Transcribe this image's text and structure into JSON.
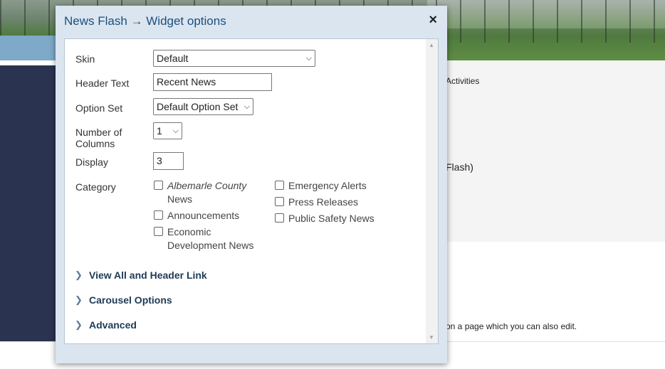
{
  "background": {
    "text1": "Activities",
    "text2": "Flash)",
    "text3": "on a page which you can also edit."
  },
  "dialog": {
    "title": "News Flash → Widget options",
    "close_icon": "×",
    "fields": {
      "skin": {
        "label": "Skin",
        "value": "Default"
      },
      "header_text": {
        "label": "Header Text",
        "value": "Recent News"
      },
      "option_set": {
        "label": "Option Set",
        "value": "Default Option Set"
      },
      "columns": {
        "label": "Number of Columns",
        "value": "1"
      },
      "display": {
        "label": "Display",
        "value": "3"
      },
      "category": {
        "label": "Category"
      }
    },
    "categories_left": [
      {
        "label": "Albemarle County",
        "sub": "News",
        "checked": false
      },
      {
        "label": "Announcements",
        "checked": false
      },
      {
        "label": "Economic",
        "sub": "Development News",
        "checked": false
      }
    ],
    "categories_right": [
      {
        "label": "Emergency Alerts",
        "checked": false
      },
      {
        "label": "Press Releases",
        "checked": false
      },
      {
        "label": "Public Safety News",
        "checked": false
      }
    ],
    "sections": [
      {
        "label": "View All and Header Link"
      },
      {
        "label": "Carousel Options"
      },
      {
        "label": "Advanced"
      }
    ]
  }
}
